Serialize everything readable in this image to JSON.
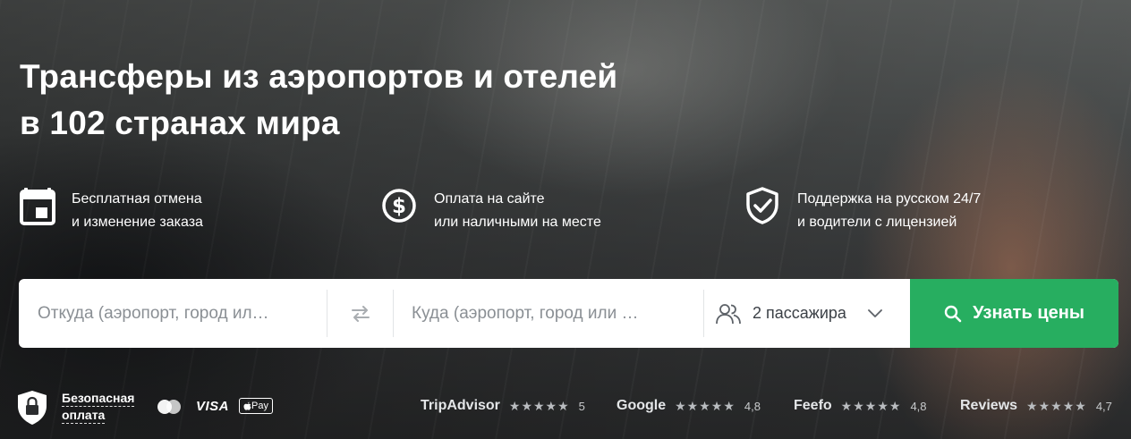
{
  "hero": {
    "title_line1": "Трансферы из аэропортов и отелей",
    "title_line2": "в 102 странах мира"
  },
  "features": [
    {
      "icon": "calendar-icon",
      "line1": "Бесплатная отмена",
      "line2": "и изменение заказа"
    },
    {
      "icon": "dollar-circle-icon",
      "line1": "Оплата на сайте",
      "line2": "или наличными на месте"
    },
    {
      "icon": "shield-check-icon",
      "line1": "Поддержка на русском 24/7",
      "line2": "и водители с лицензией"
    }
  ],
  "search": {
    "from_placeholder": "Откуда (аэропорт, город ил…",
    "to_placeholder": "Куда (аэропорт, город или …",
    "passengers_value": "2 пассажира",
    "submit_label": "Узнать цены"
  },
  "payment": {
    "secure_line1": "Безопасная",
    "secure_line2": "оплата",
    "visa_label": "VISA",
    "apple_pay_label": "Pay"
  },
  "ratings": [
    {
      "name": "TripAdvisor",
      "stars": "★★★★★",
      "score": "5"
    },
    {
      "name": "Google",
      "stars": "★★★★★",
      "score": "4,8"
    },
    {
      "name": "Feefo",
      "stars": "★★★★★",
      "score": "4,8"
    },
    {
      "name": "Reviews",
      "stars": "★★★★★",
      "score": "4,7"
    }
  ],
  "colors": {
    "accent_green": "#27ae60",
    "text_white": "#ffffff",
    "placeholder_gray": "#8a8f94"
  }
}
